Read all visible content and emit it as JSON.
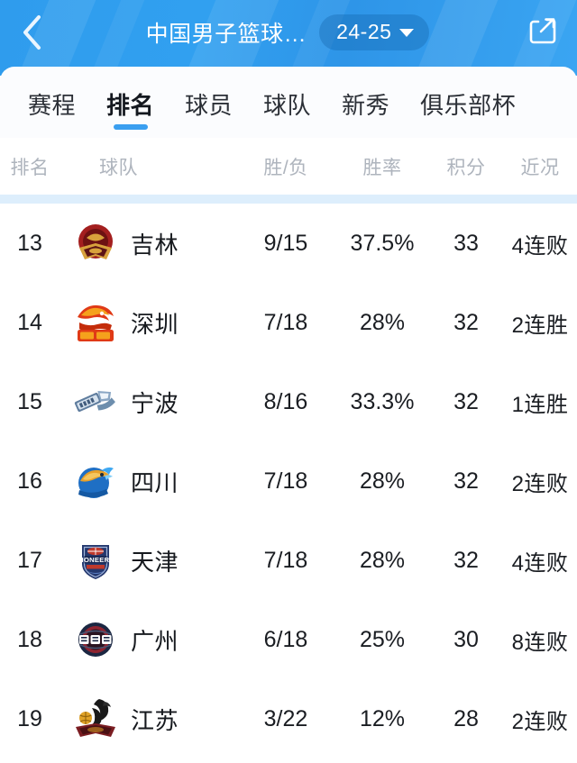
{
  "header": {
    "back_icon": "chevron-left-icon",
    "title": "中国男子篮球…",
    "season": "24-25",
    "season_caret_icon": "caret-down-icon",
    "share_icon": "share-icon",
    "background_color": "#31a0f0",
    "pill_color": "#0f5fa5"
  },
  "tabs": {
    "accent_color": "#3a9ff0",
    "items": [
      {
        "label": "赛程",
        "active": false
      },
      {
        "label": "排名",
        "active": true
      },
      {
        "label": "球员",
        "active": false
      },
      {
        "label": "球队",
        "active": false
      },
      {
        "label": "新秀",
        "active": false
      },
      {
        "label": "俱乐部杯",
        "active": false
      }
    ]
  },
  "table": {
    "columns": [
      "排名",
      "球队",
      "胜/负",
      "胜率",
      "积分",
      "近况"
    ],
    "rows": [
      {
        "rank": "13",
        "team": "吉林",
        "wl": "9/15",
        "pct": "37.5%",
        "pts": "33",
        "form": "4连败",
        "logo": {
          "name": "jilin-logo",
          "primary": "#a31f1f",
          "secondary": "#d8a23c",
          "dark": "#2b1a12"
        }
      },
      {
        "rank": "14",
        "team": "深圳",
        "wl": "7/18",
        "pct": "28%",
        "pts": "32",
        "form": "2连胜",
        "logo": {
          "name": "shenzhen-logo",
          "primary": "#e03a16",
          "secondary": "#f5a11c",
          "dark": "#8c1f08"
        }
      },
      {
        "rank": "15",
        "team": "宁波",
        "wl": "8/16",
        "pct": "33.3%",
        "pts": "32",
        "form": "1连胜",
        "logo": {
          "name": "ningbo-logo",
          "primary": "#8aa6c4",
          "secondary": "#d6e2ee",
          "dark": "#415c7d"
        }
      },
      {
        "rank": "16",
        "team": "四川",
        "wl": "7/18",
        "pct": "28%",
        "pts": "32",
        "form": "2连败",
        "logo": {
          "name": "sichuan-logo",
          "primary": "#1f6fc4",
          "secondary": "#e8a02a",
          "dark": "#123f72"
        }
      },
      {
        "rank": "17",
        "team": "天津",
        "wl": "7/18",
        "pct": "28%",
        "pts": "32",
        "form": "4连败",
        "logo": {
          "name": "tianjin-pioneers-logo",
          "primary": "#24386e",
          "secondary": "#ffffff",
          "dark": "#c0392b"
        }
      },
      {
        "rank": "18",
        "team": "广州",
        "wl": "6/18",
        "pct": "25%",
        "pts": "30",
        "form": "8连败",
        "logo": {
          "name": "guangzhou-logo",
          "primary": "#1b2742",
          "secondary": "#ffffff",
          "dark": "#8e2430"
        }
      },
      {
        "rank": "19",
        "team": "江苏",
        "wl": "3/22",
        "pct": "12%",
        "pts": "28",
        "form": "2连败",
        "logo": {
          "name": "jiangsu-logo",
          "primary": "#1a1a1a",
          "secondary": "#e0a227",
          "dark": "#7b1d22"
        }
      }
    ]
  }
}
